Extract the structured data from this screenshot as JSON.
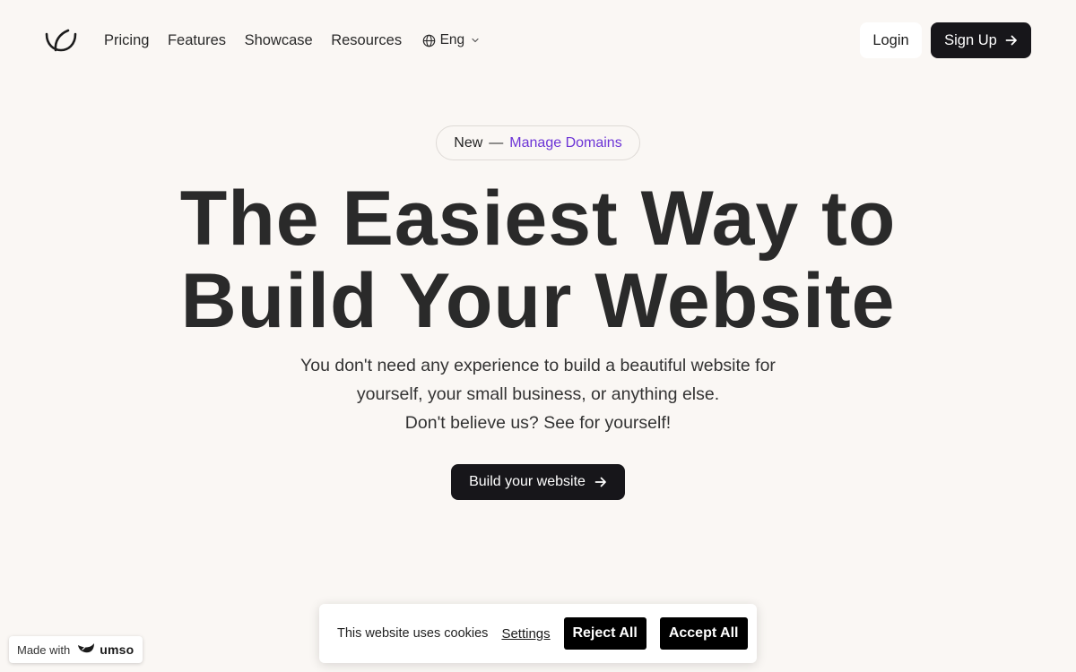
{
  "header": {
    "logo_icon": "smile-bowl-logo-icon",
    "nav": [
      {
        "label": "Pricing"
      },
      {
        "label": "Features"
      },
      {
        "label": "Showcase"
      },
      {
        "label": "Resources"
      }
    ],
    "language": {
      "label": "Eng",
      "icon": "globe-icon",
      "chevron": "chevron-down-icon"
    },
    "login_label": "Login",
    "signup_label": "Sign Up",
    "signup_icon": "arrow-right-icon"
  },
  "hero": {
    "pill": {
      "new_label": "New",
      "separator": "—",
      "link_label": "Manage Domains",
      "link_color": "#6d35d6"
    },
    "title_lines": [
      "The Easiest Way to",
      "Build Your Website"
    ],
    "subtitle_lines": [
      "You don't need any experience to build a beautiful website for",
      "yourself, your small business, or anything else.",
      "Don't believe us? See for yourself!"
    ],
    "cta_label": "Build your website",
    "cta_icon": "arrow-right-icon"
  },
  "badge": {
    "made_with": "Made with",
    "brand": "umso"
  },
  "cookie_banner": {
    "text": "This website uses cookies",
    "settings_label": "Settings",
    "reject_label": "Reject All",
    "accept_label": "Accept All"
  },
  "colors": {
    "background": "#faf7f4",
    "primary_dark": "#17161a",
    "accent_purple": "#6d35d6"
  }
}
